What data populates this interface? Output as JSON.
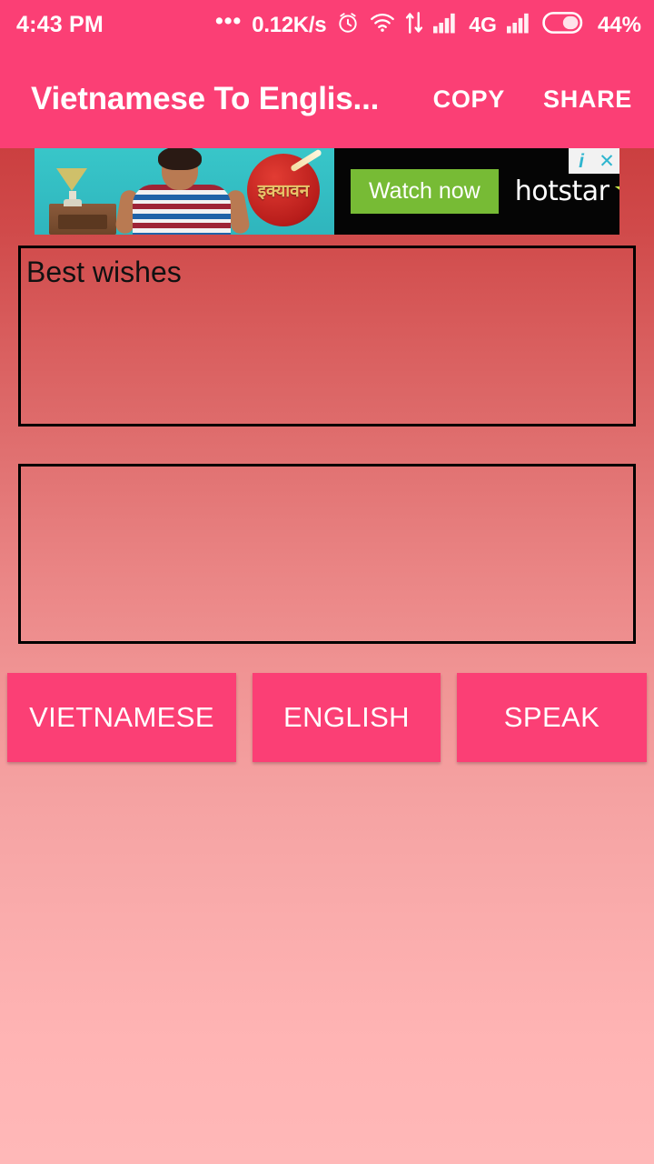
{
  "status_bar": {
    "clock": "4:43 PM",
    "overflow_dots": "•••",
    "network_speed": "0.12K/s",
    "alarm_icon": "alarm-clock-icon",
    "wifi_icon": "wifi-icon",
    "data_transfer_icon": "data-transfer-icon",
    "signal_1_icon": "signal-bars-icon",
    "network_type": "4G",
    "signal_2_icon": "signal-bars-icon",
    "battery_icon": "battery-icon",
    "battery_percent": "44%",
    "background_color": "#fb3f75",
    "text_color": "#ffffff"
  },
  "app_bar": {
    "title": "Vietnamese To Englis...",
    "actions": [
      {
        "label": "COPY",
        "name": "copy-button"
      },
      {
        "label": "SHARE",
        "name": "share-button"
      }
    ],
    "background_color": "#fb3f75"
  },
  "ad": {
    "logo_text": "इक्यावन",
    "cta_label": "Watch now",
    "brand_name": "hotstar",
    "star_glyph": "★",
    "info_badge": "i",
    "close_badge": "✕",
    "cta_color": "#77bb35",
    "badge_icon_color": "#2fb6cf",
    "background_color": "#050505"
  },
  "translator": {
    "source_text": "Best wishes",
    "source_placeholder": "",
    "target_text": "",
    "target_placeholder": "",
    "buttons": [
      {
        "label": "VIETNAMESE",
        "name": "source-language-button"
      },
      {
        "label": "ENGLISH",
        "name": "target-language-button"
      },
      {
        "label": "SPEAK",
        "name": "speak-button"
      }
    ],
    "accent_color": "#fb3f75",
    "background_gradient_top": "#cb3f40",
    "background_gradient_bottom": "#ffb8b8"
  }
}
